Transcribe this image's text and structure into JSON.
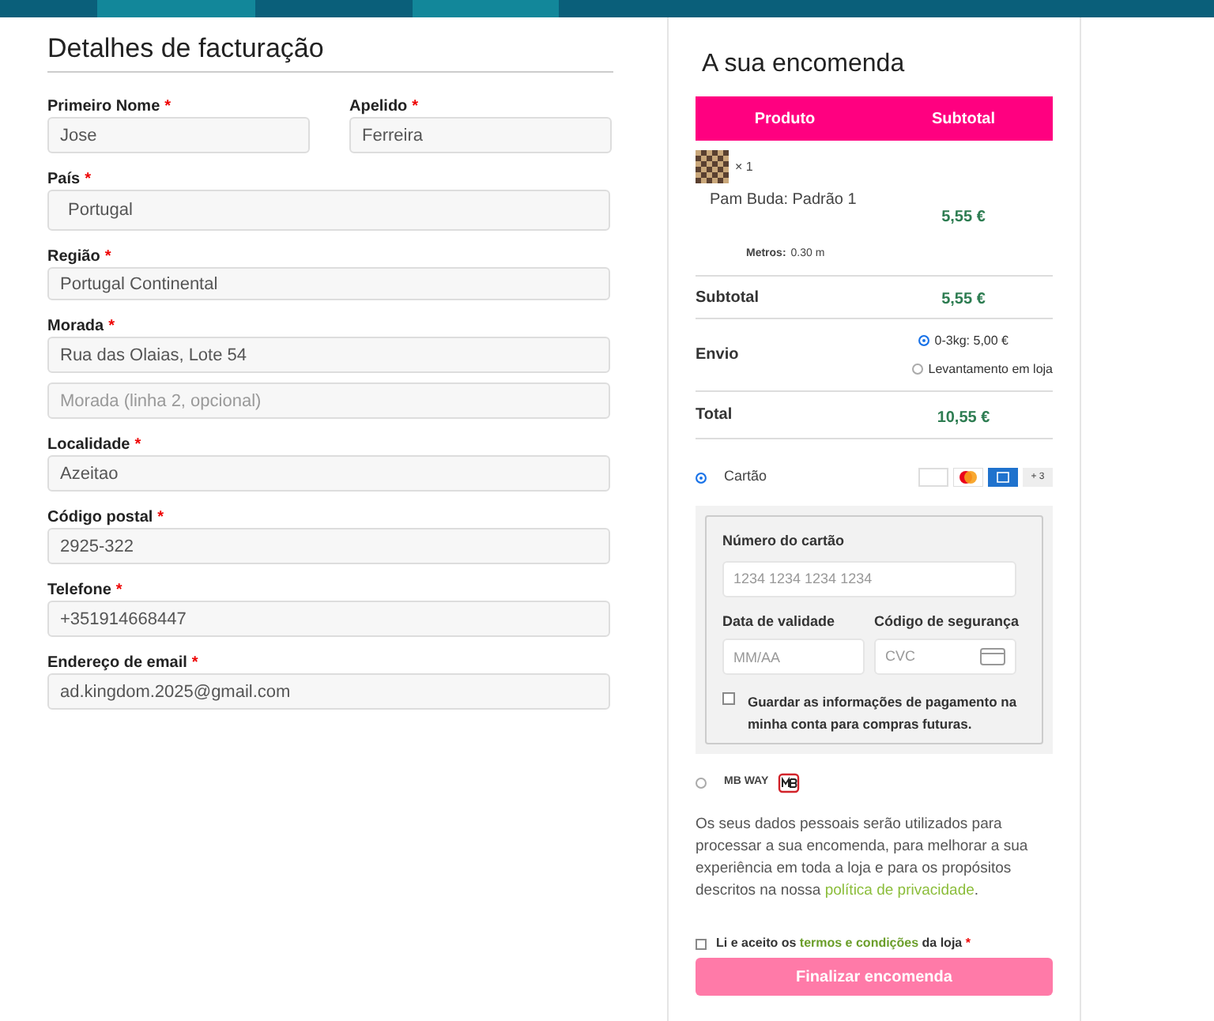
{
  "billing": {
    "title": "Detalhes de facturação",
    "name_row": [
      {
        "label": "Primeiro Nome",
        "required_mark": "*",
        "value": "Jose"
      },
      {
        "label": "Apelido",
        "required_mark": "*",
        "value": "Ferreira"
      }
    ],
    "fields": [
      {
        "label": "País",
        "required_mark": "*",
        "value": "Portugal",
        "kind": "select"
      },
      {
        "label": "Região",
        "required_mark": "*",
        "value": "Portugal Continental",
        "kind": "select"
      },
      {
        "label": "Morada",
        "required_mark": "*",
        "value": "Rua das Olaias, Lote 54",
        "kind": "text"
      },
      {
        "placeholder": "Morada (linha 2, opcional)",
        "kind": "text"
      },
      {
        "label": "Localidade",
        "required_mark": "*",
        "value": "Azeitao",
        "kind": "text"
      },
      {
        "label": "Código postal",
        "required_mark": "*",
        "value": "2925-322",
        "kind": "text"
      },
      {
        "label": "Telefone",
        "required_mark": "*",
        "value": "+351914668447",
        "kind": "text"
      },
      {
        "label": "Endereço de email",
        "required_mark": "*",
        "value": "ad.kingdom.2025@gmail.com",
        "kind": "text"
      }
    ]
  },
  "order": {
    "title": "A sua encomenda",
    "columns": [
      "Produto",
      "Subtotal"
    ],
    "item": {
      "quantity": "× 1",
      "name": "Pam Buda: Padrão 1",
      "meta_label": "Metros:",
      "meta_value": "0.30 m",
      "price": "5,55 €"
    },
    "subtotal": {
      "label": "Subtotal",
      "value": "5,55 €"
    },
    "shipping": {
      "label": "Envio",
      "options": [
        {
          "label": "0-3kg: 5,00 €",
          "selected": true
        },
        {
          "label": "Levantamento em loja",
          "selected": false
        }
      ]
    },
    "total": {
      "label": "Total",
      "value": "10,55 €"
    }
  },
  "payment": {
    "methods": [
      {
        "label": "Cartão",
        "selected": true,
        "kind": "card",
        "more_cards": "+ 3"
      },
      {
        "label": "MB WAY",
        "selected": false,
        "kind": "mbway"
      }
    ],
    "card_form": {
      "number_label": "Número do cartão",
      "number_placeholder": "1234 1234 1234 1234",
      "expiry_label": "Data de validade",
      "expiry_placeholder": "MM/AA",
      "cvc_label": "Código de segurança",
      "cvc_placeholder": "CVC",
      "save_label": "Guardar as informações de pagamento na minha conta para compras futuras.",
      "save_checked": false
    }
  },
  "privacy": {
    "before": "Os seus dados pessoais serão utilizados para processar a sua encomenda, para melhorar a sua experiência em toda a loja e para os propósitos descritos na nossa",
    "link": "política de privacidade",
    "after": "."
  },
  "terms": {
    "before": "Li e aceito os",
    "link": "termos e condições",
    "after": "da loja",
    "required_mark": "*",
    "checked": false
  },
  "submit": "Finalizar encomenda"
}
